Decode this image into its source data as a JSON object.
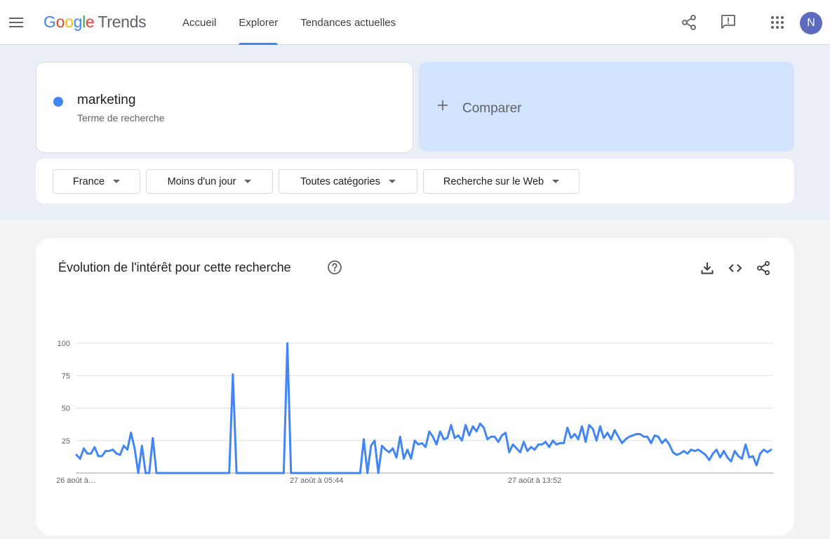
{
  "header": {
    "logo_google": [
      "G",
      "o",
      "o",
      "g",
      "l",
      "e"
    ],
    "logo_google_colors": [
      "#4285f4",
      "#ea4335",
      "#fbbc05",
      "#4285f4",
      "#34a853",
      "#ea4335"
    ],
    "logo_trends": "Trends",
    "tabs": [
      {
        "label": "Accueil",
        "active": false
      },
      {
        "label": "Explorer",
        "active": true
      },
      {
        "label": "Tendances actuelles",
        "active": false
      }
    ],
    "avatar_letter": "N",
    "icons": [
      "menu-icon",
      "share-icon",
      "feedback-icon",
      "apps-icon"
    ]
  },
  "search": {
    "term": "marketing",
    "term_type": "Terme de recherche",
    "term_color": "#4285f4",
    "compare_label": "Comparer"
  },
  "filters": {
    "region": "France",
    "period": "Moins d'un jour",
    "category": "Toutes catégories",
    "search_type": "Recherche sur le Web"
  },
  "chart": {
    "title": "Évolution de l'intérêt pour cette recherche",
    "icons": [
      "help-icon",
      "download-icon",
      "embed-icon",
      "share-icon"
    ]
  },
  "chart_data": {
    "type": "line",
    "title": "Évolution de l'intérêt pour cette recherche",
    "xlabel": "",
    "ylabel": "",
    "ylim": [
      0,
      100
    ],
    "yticks": [
      25,
      50,
      75,
      100
    ],
    "grid": true,
    "legend": "none",
    "x_tick_labels": [
      {
        "label": "26 août à…",
        "index": 0
      },
      {
        "label": "27 août à 05:44",
        "index": 66
      },
      {
        "label": "27 août à 13:52",
        "index": 126
      }
    ],
    "series": [
      {
        "color": "#4285f4",
        "values": [
          14,
          11,
          19,
          15,
          15,
          20,
          13,
          13,
          17,
          17,
          18,
          15,
          14,
          21,
          18,
          31,
          19,
          0,
          21,
          0,
          0,
          27,
          0,
          0,
          0,
          0,
          0,
          0,
          0,
          0,
          0,
          0,
          0,
          0,
          0,
          0,
          0,
          0,
          0,
          0,
          0,
          0,
          0,
          76,
          0,
          0,
          0,
          0,
          0,
          0,
          0,
          0,
          0,
          0,
          0,
          0,
          0,
          0,
          100,
          0,
          0,
          0,
          0,
          0,
          0,
          0,
          0,
          0,
          0,
          0,
          0,
          0,
          0,
          0,
          0,
          0,
          0,
          0,
          0,
          26,
          0,
          21,
          25,
          0,
          21,
          18,
          16,
          19,
          12,
          28,
          11,
          18,
          11,
          25,
          22,
          23,
          20,
          32,
          28,
          22,
          32,
          26,
          27,
          37,
          27,
          29,
          25,
          37,
          29,
          36,
          32,
          38,
          35,
          26,
          28,
          28,
          24,
          29,
          31,
          16,
          22,
          19,
          16,
          24,
          17,
          20,
          18,
          22,
          22,
          24,
          20,
          25,
          22,
          23,
          23,
          35,
          27,
          30,
          26,
          36,
          24,
          37,
          34,
          25,
          36,
          27,
          31,
          26,
          33,
          28,
          23,
          26,
          28,
          29,
          30,
          30,
          28,
          28,
          23,
          29,
          28,
          23,
          26,
          22,
          16,
          14,
          15,
          17,
          15,
          18,
          17,
          18,
          16,
          14,
          10,
          15,
          18,
          12,
          17,
          12,
          9,
          17,
          13,
          11,
          22,
          12,
          13,
          6,
          15,
          18,
          16,
          18
        ]
      }
    ]
  }
}
